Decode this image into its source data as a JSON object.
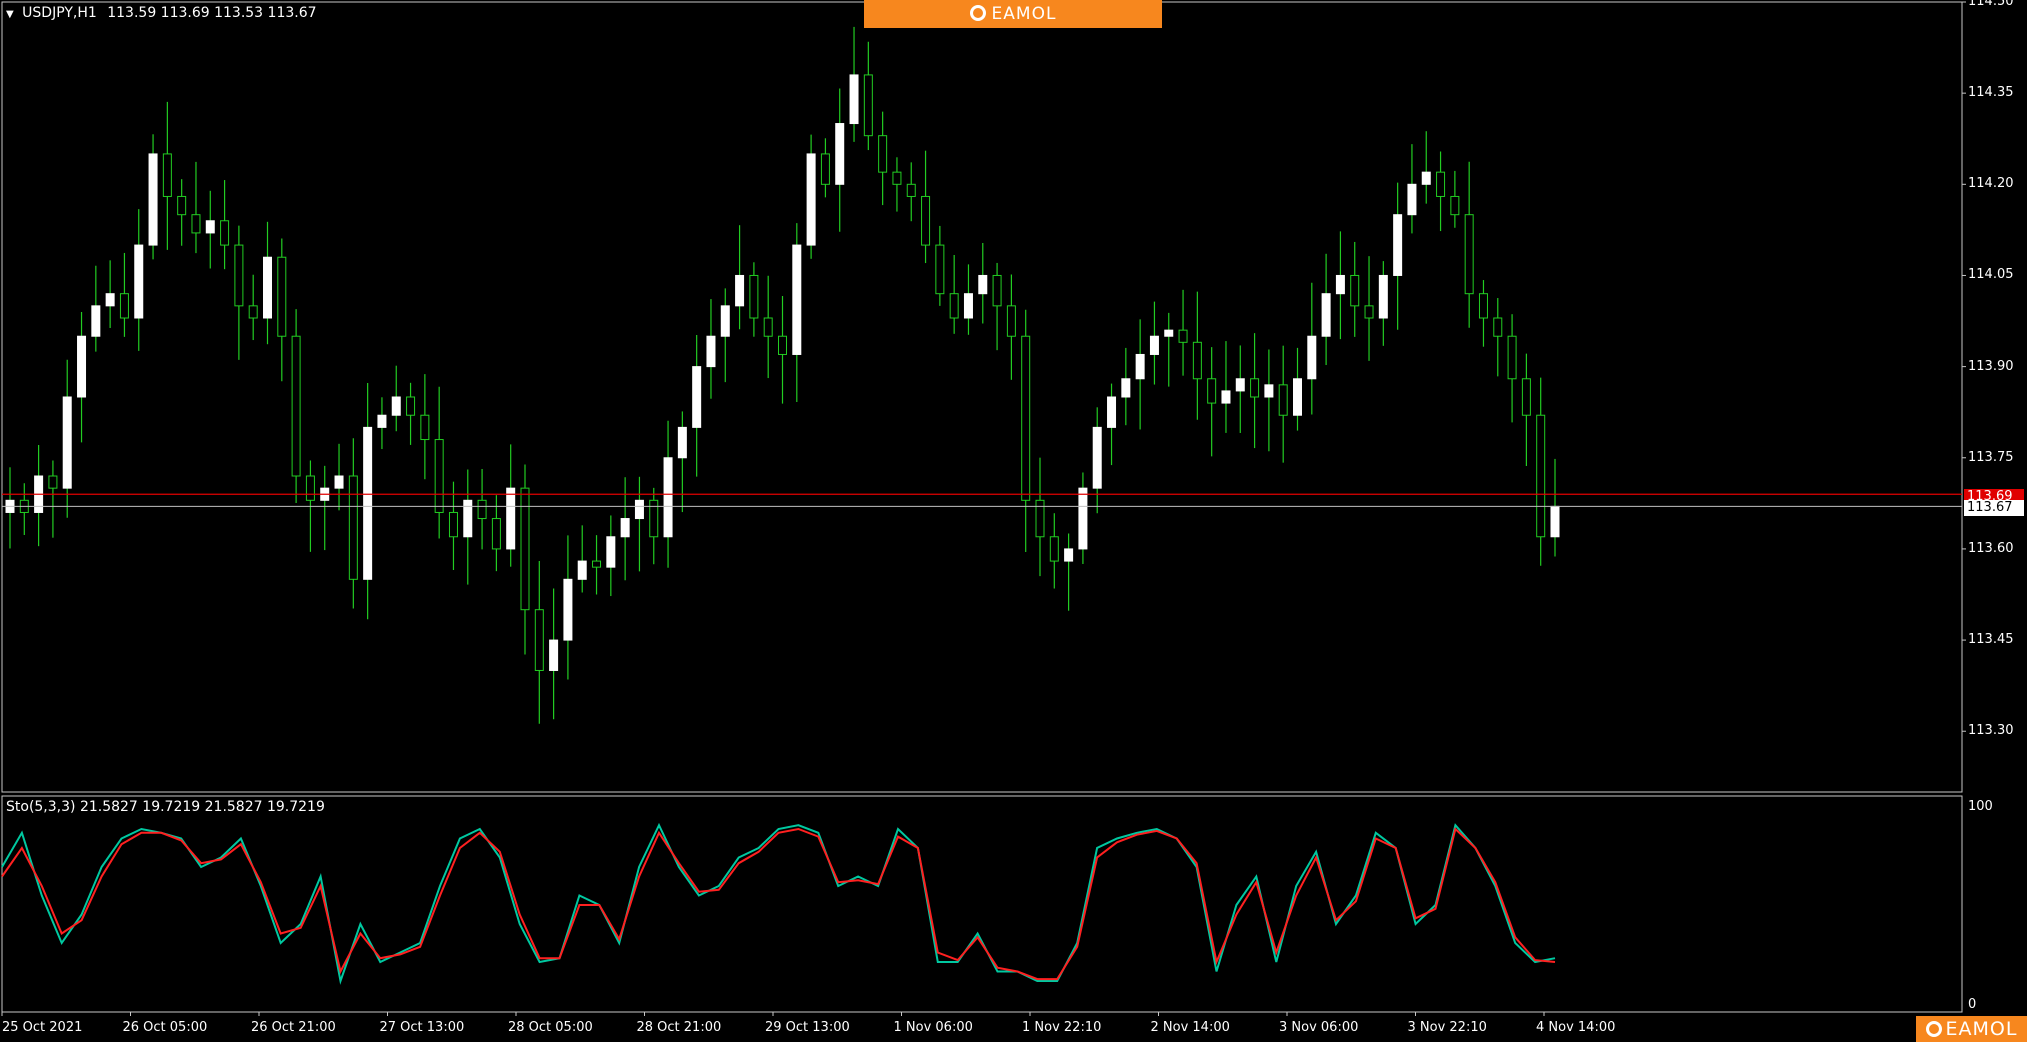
{
  "chart_header": {
    "symbol_tf": "USDJPY,H1",
    "ohlc": "113.59 113.69 113.53 113.67"
  },
  "banner": {
    "brand": "EAMOL"
  },
  "watermark": {
    "brand": "EAMOL"
  },
  "stochastic": {
    "label": "Sto(5,3,3) 21.5827 19.7219 21.5827 19.7219",
    "y_max_label": "100",
    "y_min_label": "0"
  },
  "price_tags": {
    "ask": "113.69",
    "bid": "113.67"
  },
  "colors": {
    "background": "#000000",
    "up_candle_body": "#ffffff",
    "wick": "#22cc22",
    "ask_line": "#e00000",
    "bid_line": "#c0c0c0",
    "stoch_main": "#00c8a0",
    "stoch_signal": "#ff2020",
    "brand_orange": "#f7871e"
  },
  "chart_data": [
    {
      "type": "candlestick",
      "title": "USDJPY,H1",
      "ylim": [
        113.2,
        114.5
      ],
      "y_ticks": [
        "114.50",
        "114.35",
        "114.20",
        "114.05",
        "113.90",
        "113.75",
        "113.60",
        "113.45",
        "113.30"
      ],
      "x_ticks": [
        "25 Oct 2021",
        "26 Oct 05:00",
        "26 Oct 21:00",
        "27 Oct 13:00",
        "28 Oct 05:00",
        "28 Oct 21:00",
        "29 Oct 13:00",
        "1 Nov 06:00",
        "1 Nov 22:10",
        "2 Nov 14:00",
        "3 Nov 06:00",
        "3 Nov 22:10",
        "4 Nov 14:00"
      ],
      "ask_price": 113.69,
      "bid_price": 113.67,
      "close_path": [
        113.68,
        113.66,
        113.72,
        113.7,
        113.85,
        113.95,
        114.0,
        114.02,
        113.98,
        114.1,
        114.25,
        114.18,
        114.15,
        114.12,
        114.14,
        114.1,
        114.0,
        113.98,
        114.08,
        113.95,
        113.72,
        113.68,
        113.7,
        113.72,
        113.55,
        113.8,
        113.82,
        113.85,
        113.82,
        113.78,
        113.66,
        113.62,
        113.68,
        113.65,
        113.6,
        113.7,
        113.5,
        113.4,
        113.45,
        113.55,
        113.58,
        113.57,
        113.62,
        113.65,
        113.68,
        113.62,
        113.75,
        113.8,
        113.9,
        113.95,
        114.0,
        114.05,
        113.98,
        113.95,
        113.92,
        114.1,
        114.25,
        114.2,
        114.3,
        114.38,
        114.28,
        114.22,
        114.2,
        114.18,
        114.1,
        114.02,
        113.98,
        114.02,
        114.05,
        114.0,
        113.95,
        113.68,
        113.62,
        113.58,
        113.6,
        113.7,
        113.8,
        113.85,
        113.88,
        113.92,
        113.95,
        113.96,
        113.94,
        113.88,
        113.84,
        113.86,
        113.88,
        113.85,
        113.87,
        113.82,
        113.88,
        113.95,
        114.02,
        114.05,
        114.0,
        113.98,
        114.05,
        114.15,
        114.2,
        114.22,
        114.18,
        114.15,
        114.02,
        113.98,
        113.95,
        113.88,
        113.82,
        113.62,
        113.67
      ]
    },
    {
      "type": "line",
      "title": "Sto(5,3,3)",
      "ylim": [
        0,
        100
      ],
      "series": [
        {
          "name": "main",
          "values": [
            70,
            88,
            55,
            30,
            45,
            70,
            85,
            90,
            88,
            85,
            70,
            75,
            85,
            60,
            30,
            40,
            65,
            10,
            40,
            20,
            25,
            30,
            60,
            85,
            90,
            75,
            40,
            20,
            22,
            55,
            50,
            30,
            70,
            92,
            70,
            55,
            60,
            75,
            80,
            90,
            92,
            88,
            60,
            65,
            60,
            90,
            80,
            20,
            20,
            35,
            15,
            15,
            10,
            10,
            30,
            80,
            85,
            88,
            90,
            85,
            70,
            15,
            50,
            65,
            20,
            60,
            78,
            40,
            55,
            88,
            80,
            40,
            50,
            92,
            80,
            60,
            30,
            20,
            22
          ]
        },
        {
          "name": "signal",
          "values": [
            65,
            80,
            60,
            35,
            42,
            65,
            82,
            88,
            88,
            84,
            72,
            74,
            82,
            62,
            35,
            38,
            60,
            15,
            35,
            22,
            24,
            28,
            55,
            80,
            88,
            78,
            45,
            22,
            22,
            50,
            50,
            32,
            65,
            88,
            72,
            57,
            58,
            72,
            78,
            88,
            90,
            86,
            62,
            63,
            61,
            86,
            80,
            25,
            21,
            33,
            17,
            15,
            11,
            11,
            28,
            75,
            83,
            87,
            89,
            85,
            72,
            20,
            45,
            62,
            25,
            55,
            75,
            42,
            52,
            85,
            80,
            43,
            48,
            90,
            80,
            62,
            33,
            21,
            20
          ]
        }
      ]
    }
  ]
}
